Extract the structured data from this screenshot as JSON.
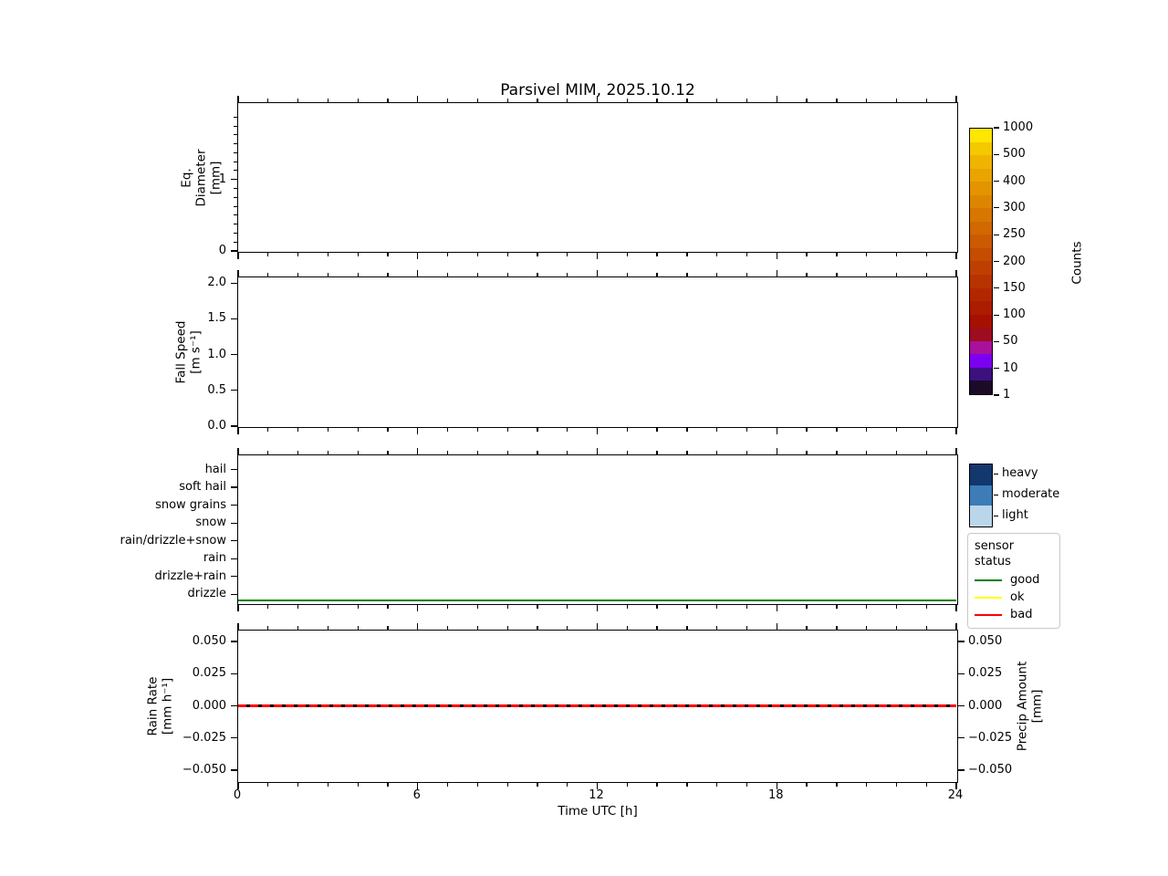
{
  "title": "Parsivel MIM, 2025.10.12",
  "xaxis": {
    "label": "Time UTC [h]",
    "xlim": [
      0,
      24
    ],
    "major_ticks": [
      "0",
      "6",
      "12",
      "18",
      "24"
    ],
    "minor_step_h": 1
  },
  "panels": [
    {
      "key": "eq-diameter",
      "ylabel_lines": [
        "Eq.",
        "Diameter",
        "[mm]"
      ],
      "ylim": [
        0,
        2.07
      ],
      "yticks": [
        {
          "v": 1,
          "label": "1"
        },
        {
          "v": 0,
          "label": "0"
        }
      ],
      "y_minor_step": 0.125
    },
    {
      "key": "fall-speed",
      "ylabel_lines": [
        "Fall Speed",
        "[m s⁻¹]"
      ],
      "ylim": [
        0,
        2.08
      ],
      "yticks": [
        {
          "v": 2.0,
          "label": "2.0"
        },
        {
          "v": 1.5,
          "label": "1.5"
        },
        {
          "v": 1.0,
          "label": "1.0"
        },
        {
          "v": 0.5,
          "label": "0.5"
        },
        {
          "v": 0.0,
          "label": "0.0"
        }
      ]
    },
    {
      "key": "precip-type",
      "categories_top_to_bottom": [
        "hail",
        "soft hail",
        "snow grains",
        "snow",
        "rain/drizzle+snow",
        "rain",
        "drizzle+rain",
        "drizzle"
      ],
      "ylim": [
        0,
        8.3
      ],
      "line": {
        "name": "sensor-status-line",
        "color": "#008000",
        "value": 0.15,
        "thickness": 2.6
      }
    },
    {
      "key": "rain-rate",
      "ylabel_lines": [
        "Rain Rate",
        "[mm h⁻¹]"
      ],
      "ylabel_right_lines": [
        "Precip Amount",
        "[mm]"
      ],
      "ylim": [
        -0.0585,
        0.0585
      ],
      "yticks": [
        {
          "v": 0.05,
          "label": "0.050"
        },
        {
          "v": 0.025,
          "label": "0.025"
        },
        {
          "v": 0,
          "label": "0.000"
        },
        {
          "v": -0.025,
          "label": "−0.025"
        },
        {
          "v": -0.05,
          "label": "−0.050"
        }
      ],
      "right_yticks": true,
      "line": {
        "name": "rain-rate-line",
        "style": "red-black-dashed",
        "value": 0,
        "thickness": 3
      }
    }
  ],
  "colorbar": {
    "label": "Counts",
    "tick_labels_top_to_bottom": [
      "1000",
      "500",
      "400",
      "300",
      "250",
      "200",
      "150",
      "100",
      "50",
      "10",
      "1"
    ],
    "segment_colors_top_to_bottom": [
      "#ffe600",
      "#f5c800",
      "#efb400",
      "#e9a400",
      "#e39400",
      "#dd8500",
      "#d77600",
      "#d16800",
      "#cb5a00",
      "#c54c00",
      "#bf3f00",
      "#b93300",
      "#b32700",
      "#ad1b00",
      "#a71000",
      "#9d0d1e",
      "#a9119b",
      "#7c00f0",
      "#3d1080",
      "#1b0b28"
    ]
  },
  "intensity_legend": {
    "items": [
      {
        "label": "heavy",
        "color": "#12386e"
      },
      {
        "label": "moderate",
        "color": "#3d7cb7"
      },
      {
        "label": "light",
        "color": "#bad6eb"
      }
    ]
  },
  "status_legend": {
    "title": "sensor status",
    "items": [
      {
        "label": "good",
        "color": "#008000"
      },
      {
        "label": "ok",
        "color": "#ffff00"
      },
      {
        "label": "bad",
        "color": "#ff0000"
      }
    ]
  },
  "chart_data": [
    {
      "type": "heatmap",
      "panel": "Eq. Diameter",
      "title": "Parsivel MIM, 2025.10.12",
      "ylabel": "Eq. Diameter [mm]",
      "xlim_h": [
        0,
        24
      ],
      "ylim": [
        0,
        2.07
      ],
      "yticks": [
        0,
        1
      ],
      "values": "empty — zero counts all day",
      "colorbar_label": "Counts",
      "colorbar_levels": [
        1,
        10,
        50,
        100,
        150,
        200,
        250,
        300,
        400,
        500,
        1000
      ]
    },
    {
      "type": "heatmap",
      "panel": "Fall Speed",
      "ylabel": "Fall Speed [m s⁻¹]",
      "xlim_h": [
        0,
        24
      ],
      "ylim": [
        0,
        2.08
      ],
      "yticks": [
        0.0,
        0.5,
        1.0,
        1.5,
        2.0
      ],
      "values": "empty — zero counts all day"
    },
    {
      "type": "line",
      "panel": "Precipitation type / sensor status",
      "categories_bottom_to_top": [
        "drizzle",
        "drizzle+rain",
        "rain",
        "rain/drizzle+snow",
        "snow",
        "snow grains",
        "soft hail",
        "hail"
      ],
      "intensity_classes": [
        "light",
        "moderate",
        "heavy"
      ],
      "series": [
        {
          "name": "sensor status",
          "value": "good (constant from 0 to 24 h)",
          "color": "#008000"
        }
      ]
    },
    {
      "type": "line",
      "panel": "Rain Rate / Precip Amount",
      "ylabel_left": "Rain Rate [mm h⁻¹]",
      "ylabel_right": "Precip Amount [mm]",
      "xlabel": "Time UTC [h]",
      "xlim_h": [
        0,
        24
      ],
      "ylim": [
        -0.0585,
        0.0585
      ],
      "yticks": [
        -0.05,
        -0.025,
        0.0,
        0.025,
        0.05
      ],
      "series": [
        {
          "name": "Rain Rate",
          "constant_value": 0.0,
          "color": "#ff0000",
          "style": "solid"
        },
        {
          "name": "Precip Amount",
          "constant_value": 0.0,
          "color": "#000000",
          "style": "dashed"
        }
      ]
    }
  ]
}
